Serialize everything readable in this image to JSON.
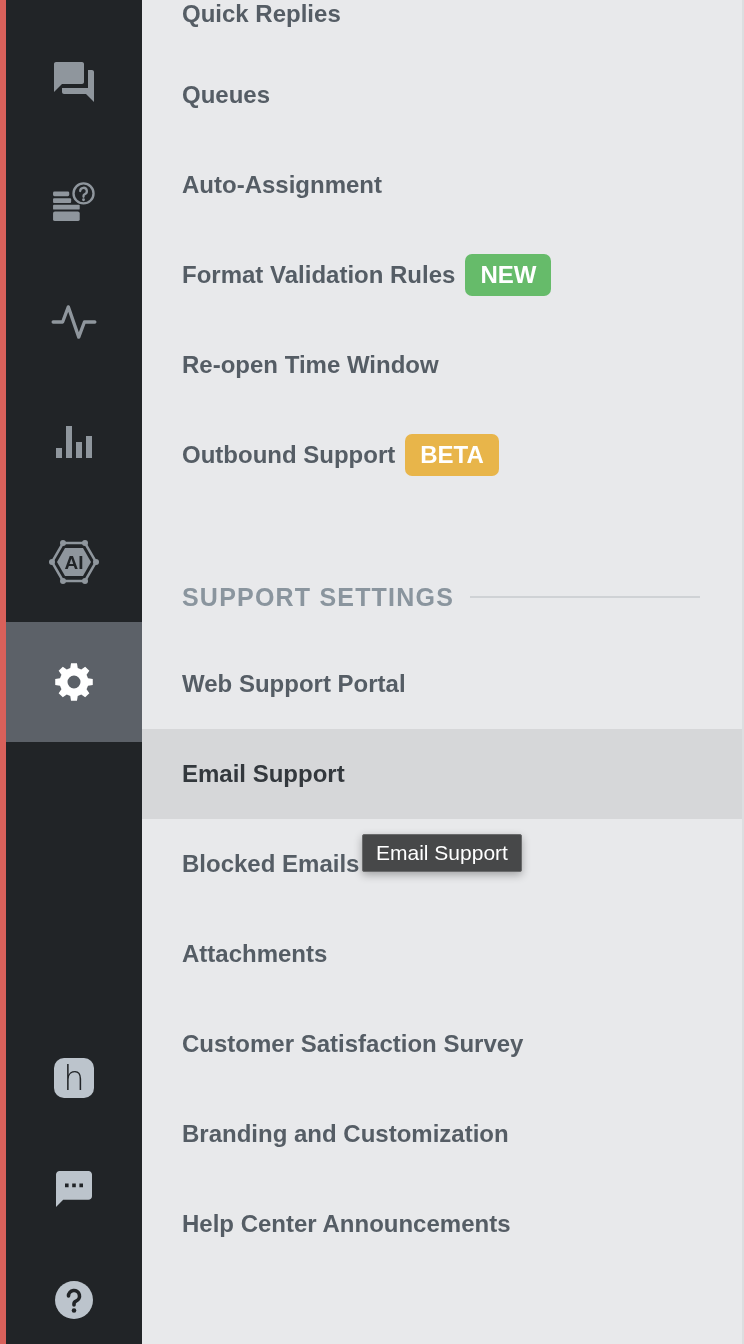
{
  "sidebar": {
    "items": [
      {
        "selected": false
      },
      {
        "selected": false
      },
      {
        "selected": false
      },
      {
        "selected": false
      },
      {
        "selected": false,
        "icon_text": "AI"
      },
      {
        "selected": true
      }
    ],
    "footer": {
      "logo_text": "h"
    }
  },
  "menu": {
    "items": [
      {
        "label": "Quick Replies",
        "selected": false
      },
      {
        "label": "Queues",
        "selected": false
      },
      {
        "label": "Auto-Assignment",
        "selected": false
      },
      {
        "label": "Format Validation Rules",
        "selected": false,
        "badge": {
          "text": "NEW",
          "color": "#66bb6a"
        }
      },
      {
        "label": "Re-open Time Window",
        "selected": false
      },
      {
        "label": "Outbound Support",
        "selected": false,
        "badge": {
          "text": "BETA",
          "color": "#e8b54a"
        }
      }
    ]
  },
  "support_settings": {
    "heading": "SUPPORT SETTINGS",
    "items": [
      {
        "label": "Web Support Portal",
        "selected": false
      },
      {
        "label": "Email Support",
        "selected": true
      },
      {
        "label": "Blocked Emails",
        "selected": false
      },
      {
        "label": "Attachments",
        "selected": false
      },
      {
        "label": "Customer Satisfaction Survey",
        "selected": false
      },
      {
        "label": "Branding and Customization",
        "selected": false
      },
      {
        "label": "Help Center Announcements",
        "selected": false
      }
    ]
  },
  "tooltip": {
    "text": "Email Support"
  }
}
